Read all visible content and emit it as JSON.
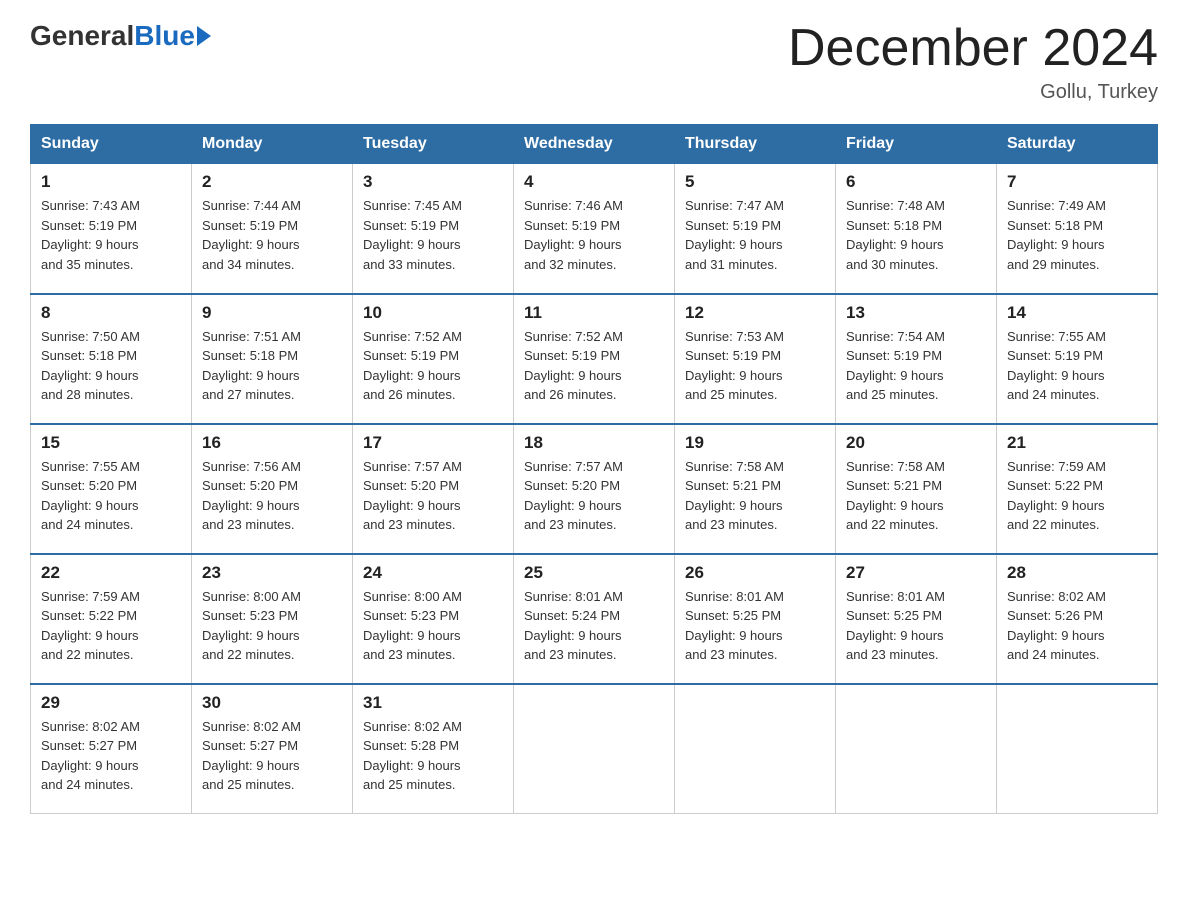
{
  "logo": {
    "general": "General",
    "blue": "Blue"
  },
  "title": "December 2024",
  "subtitle": "Gollu, Turkey",
  "days_of_week": [
    "Sunday",
    "Monday",
    "Tuesday",
    "Wednesday",
    "Thursday",
    "Friday",
    "Saturday"
  ],
  "weeks": [
    [
      {
        "day": "1",
        "sunrise": "7:43 AM",
        "sunset": "5:19 PM",
        "daylight": "9 hours and 35 minutes."
      },
      {
        "day": "2",
        "sunrise": "7:44 AM",
        "sunset": "5:19 PM",
        "daylight": "9 hours and 34 minutes."
      },
      {
        "day": "3",
        "sunrise": "7:45 AM",
        "sunset": "5:19 PM",
        "daylight": "9 hours and 33 minutes."
      },
      {
        "day": "4",
        "sunrise": "7:46 AM",
        "sunset": "5:19 PM",
        "daylight": "9 hours and 32 minutes."
      },
      {
        "day": "5",
        "sunrise": "7:47 AM",
        "sunset": "5:19 PM",
        "daylight": "9 hours and 31 minutes."
      },
      {
        "day": "6",
        "sunrise": "7:48 AM",
        "sunset": "5:18 PM",
        "daylight": "9 hours and 30 minutes."
      },
      {
        "day": "7",
        "sunrise": "7:49 AM",
        "sunset": "5:18 PM",
        "daylight": "9 hours and 29 minutes."
      }
    ],
    [
      {
        "day": "8",
        "sunrise": "7:50 AM",
        "sunset": "5:18 PM",
        "daylight": "9 hours and 28 minutes."
      },
      {
        "day": "9",
        "sunrise": "7:51 AM",
        "sunset": "5:18 PM",
        "daylight": "9 hours and 27 minutes."
      },
      {
        "day": "10",
        "sunrise": "7:52 AM",
        "sunset": "5:19 PM",
        "daylight": "9 hours and 26 minutes."
      },
      {
        "day": "11",
        "sunrise": "7:52 AM",
        "sunset": "5:19 PM",
        "daylight": "9 hours and 26 minutes."
      },
      {
        "day": "12",
        "sunrise": "7:53 AM",
        "sunset": "5:19 PM",
        "daylight": "9 hours and 25 minutes."
      },
      {
        "day": "13",
        "sunrise": "7:54 AM",
        "sunset": "5:19 PM",
        "daylight": "9 hours and 25 minutes."
      },
      {
        "day": "14",
        "sunrise": "7:55 AM",
        "sunset": "5:19 PM",
        "daylight": "9 hours and 24 minutes."
      }
    ],
    [
      {
        "day": "15",
        "sunrise": "7:55 AM",
        "sunset": "5:20 PM",
        "daylight": "9 hours and 24 minutes."
      },
      {
        "day": "16",
        "sunrise": "7:56 AM",
        "sunset": "5:20 PM",
        "daylight": "9 hours and 23 minutes."
      },
      {
        "day": "17",
        "sunrise": "7:57 AM",
        "sunset": "5:20 PM",
        "daylight": "9 hours and 23 minutes."
      },
      {
        "day": "18",
        "sunrise": "7:57 AM",
        "sunset": "5:20 PM",
        "daylight": "9 hours and 23 minutes."
      },
      {
        "day": "19",
        "sunrise": "7:58 AM",
        "sunset": "5:21 PM",
        "daylight": "9 hours and 23 minutes."
      },
      {
        "day": "20",
        "sunrise": "7:58 AM",
        "sunset": "5:21 PM",
        "daylight": "9 hours and 22 minutes."
      },
      {
        "day": "21",
        "sunrise": "7:59 AM",
        "sunset": "5:22 PM",
        "daylight": "9 hours and 22 minutes."
      }
    ],
    [
      {
        "day": "22",
        "sunrise": "7:59 AM",
        "sunset": "5:22 PM",
        "daylight": "9 hours and 22 minutes."
      },
      {
        "day": "23",
        "sunrise": "8:00 AM",
        "sunset": "5:23 PM",
        "daylight": "9 hours and 22 minutes."
      },
      {
        "day": "24",
        "sunrise": "8:00 AM",
        "sunset": "5:23 PM",
        "daylight": "9 hours and 23 minutes."
      },
      {
        "day": "25",
        "sunrise": "8:01 AM",
        "sunset": "5:24 PM",
        "daylight": "9 hours and 23 minutes."
      },
      {
        "day": "26",
        "sunrise": "8:01 AM",
        "sunset": "5:25 PM",
        "daylight": "9 hours and 23 minutes."
      },
      {
        "day": "27",
        "sunrise": "8:01 AM",
        "sunset": "5:25 PM",
        "daylight": "9 hours and 23 minutes."
      },
      {
        "day": "28",
        "sunrise": "8:02 AM",
        "sunset": "5:26 PM",
        "daylight": "9 hours and 24 minutes."
      }
    ],
    [
      {
        "day": "29",
        "sunrise": "8:02 AM",
        "sunset": "5:27 PM",
        "daylight": "9 hours and 24 minutes."
      },
      {
        "day": "30",
        "sunrise": "8:02 AM",
        "sunset": "5:27 PM",
        "daylight": "9 hours and 25 minutes."
      },
      {
        "day": "31",
        "sunrise": "8:02 AM",
        "sunset": "5:28 PM",
        "daylight": "9 hours and 25 minutes."
      },
      null,
      null,
      null,
      null
    ]
  ],
  "labels": {
    "sunrise": "Sunrise:",
    "sunset": "Sunset:",
    "daylight": "Daylight:"
  }
}
